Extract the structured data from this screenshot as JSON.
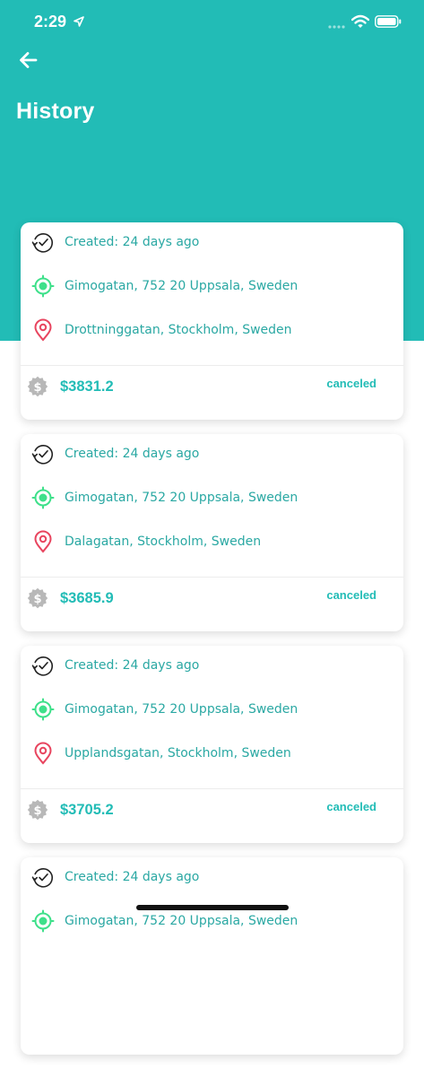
{
  "status_bar": {
    "time": "2:29"
  },
  "header": {
    "title": "History"
  },
  "colors": {
    "accent": "#22bcb6",
    "location_green": "#3ee08a",
    "pin_red": "#e8455f",
    "coin_gray": "#b8b8b8"
  },
  "icons": {
    "back": "arrow-left-icon",
    "created": "clock-history-icon",
    "from": "crosshair-location-icon",
    "to": "map-pin-icon",
    "price": "dollar-coin-icon"
  },
  "trips": [
    {
      "created": "Created: 24 days ago",
      "from": "Gimogatan, 752 20 Uppsala, Sweden",
      "to": "Drottninggatan, Stockholm, Sweden",
      "price": "$3831.2",
      "status": "canceled"
    },
    {
      "created": "Created: 24 days ago",
      "from": "Gimogatan, 752 20 Uppsala, Sweden",
      "to": "Dalagatan, Stockholm, Sweden",
      "price": "$3685.9",
      "status": "canceled"
    },
    {
      "created": "Created: 24 days ago",
      "from": "Gimogatan, 752 20 Uppsala, Sweden",
      "to": "Upplandsgatan, Stockholm, Sweden",
      "price": "$3705.2",
      "status": "canceled"
    },
    {
      "created": "Created: 24 days ago",
      "from": "Gimogatan, 752 20 Uppsala, Sweden",
      "to": "",
      "price": "",
      "status": ""
    }
  ]
}
